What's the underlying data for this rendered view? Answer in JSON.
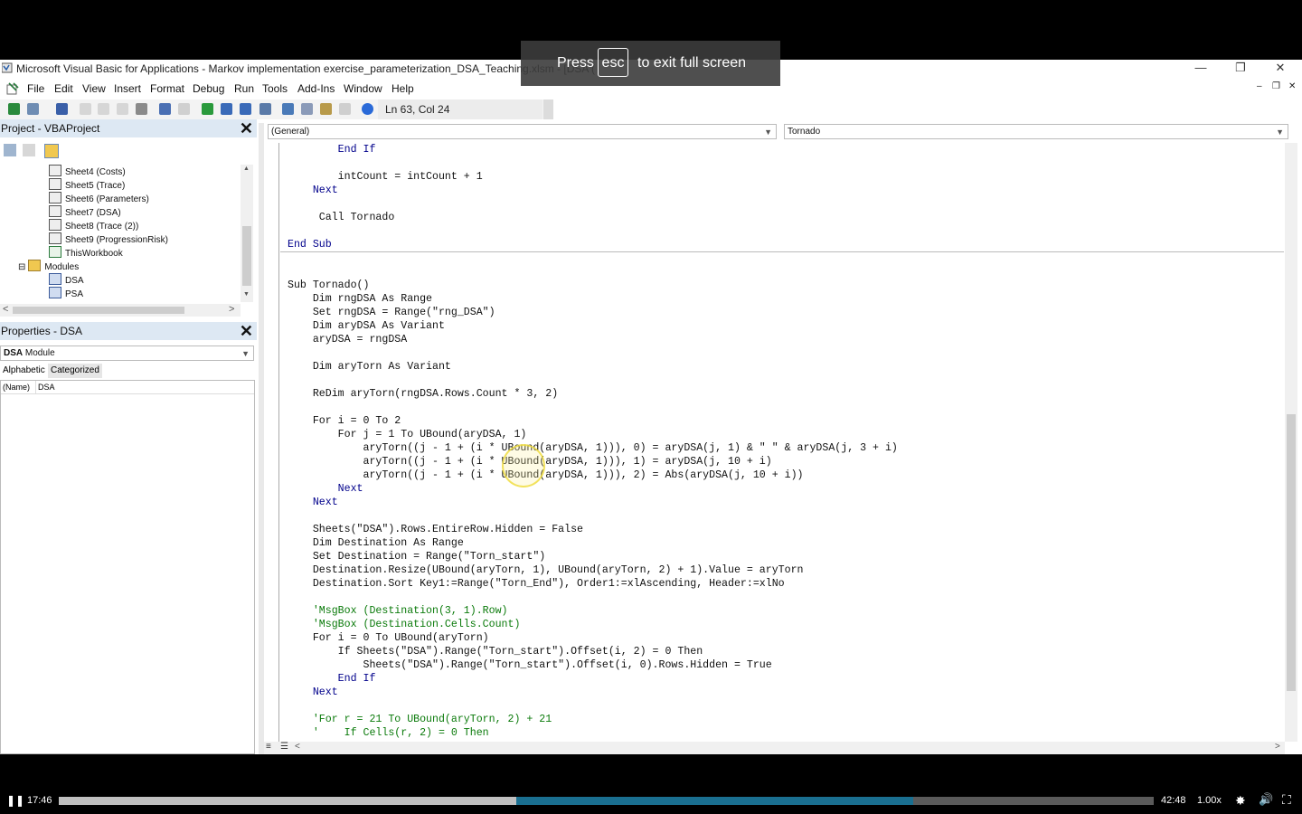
{
  "window": {
    "title": "Microsoft Visual Basic for Applications - Markov implementation exercise_parameterization_DSA_Teaching.xlsm - [DSA (",
    "minimize": "—",
    "restore": "❐",
    "close": "✕"
  },
  "menu": {
    "items": [
      "File",
      "Edit",
      "View",
      "Insert",
      "Format",
      "Debug",
      "Run",
      "Tools",
      "Add-Ins",
      "Window",
      "Help"
    ],
    "mdi_minimize": "–",
    "mdi_restore": "❐",
    "mdi_close": "✕"
  },
  "toolbar": {
    "position": "Ln 63, Col 24"
  },
  "project_pane": {
    "title": "Project - VBAProject",
    "close": "✕",
    "items": [
      {
        "label": "Sheet4 (Costs)",
        "type": "sheet"
      },
      {
        "label": "Sheet5 (Trace)",
        "type": "sheet"
      },
      {
        "label": "Sheet6 (Parameters)",
        "type": "sheet"
      },
      {
        "label": "Sheet7 (DSA)",
        "type": "sheet"
      },
      {
        "label": "Sheet8 (Trace (2))",
        "type": "sheet"
      },
      {
        "label": "Sheet9 (ProgressionRisk)",
        "type": "sheet"
      },
      {
        "label": "ThisWorkbook",
        "type": "workbook"
      },
      {
        "label": "Modules",
        "type": "folder",
        "expander": "⊟"
      },
      {
        "label": "DSA",
        "type": "module"
      },
      {
        "label": "PSA",
        "type": "module"
      }
    ],
    "scroll_left": "<",
    "scroll_right": ">",
    "scroll_up": "▲",
    "scroll_down": "▼"
  },
  "properties_pane": {
    "title": "Properties - DSA",
    "close": "✕",
    "object_selector_bold": "DSA",
    "object_selector_rest": " Module",
    "tabs": [
      "Alphabetic",
      "Categorized"
    ],
    "rows": [
      {
        "key": "(Name)",
        "value": "DSA"
      }
    ]
  },
  "code_window": {
    "object_dropdown": "(General)",
    "procedure_dropdown": "Tornado",
    "lines_top": [
      {
        "text": "        End If",
        "cls": "kw"
      },
      {
        "text": "",
        "cls": ""
      },
      {
        "text": "        intCount = intCount + 1",
        "cls": ""
      },
      {
        "text": "    Next",
        "cls": "kw"
      },
      {
        "text": "",
        "cls": ""
      },
      {
        "text": "     Call Tornado",
        "cls": ""
      },
      {
        "text": "",
        "cls": ""
      },
      {
        "text": "End Sub",
        "cls": "kw"
      }
    ],
    "lines_bottom": [
      {
        "text": "Sub Tornado()",
        "cls": ""
      },
      {
        "text": "    Dim rngDSA As Range",
        "cls": ""
      },
      {
        "text": "    Set rngDSA = Range(\"rng_DSA\")",
        "cls": ""
      },
      {
        "text": "    Dim aryDSA As Variant",
        "cls": ""
      },
      {
        "text": "    aryDSA = rngDSA",
        "cls": ""
      },
      {
        "text": "",
        "cls": ""
      },
      {
        "text": "    Dim aryTorn As Variant",
        "cls": ""
      },
      {
        "text": "",
        "cls": ""
      },
      {
        "text": "    ReDim aryTorn(rngDSA.Rows.Count * 3, 2)",
        "cls": ""
      },
      {
        "text": "",
        "cls": ""
      },
      {
        "text": "    For i = 0 To 2",
        "cls": ""
      },
      {
        "text": "        For j = 1 To UBound(aryDSA, 1)",
        "cls": ""
      },
      {
        "text": "            aryTorn((j - 1 + (i * UBound(aryDSA, 1))), 0) = aryDSA(j, 1) & \" \" & aryDSA(j, 3 + i)",
        "cls": ""
      },
      {
        "text": "            aryTorn((j - 1 + (i * UBound(aryDSA, 1))), 1) = aryDSA(j, 10 + i)",
        "cls": ""
      },
      {
        "text": "            aryTorn((j - 1 + (i * UBound(aryDSA, 1))), 2) = Abs(aryDSA(j, 10 + i))",
        "cls": ""
      },
      {
        "text": "        Next",
        "cls": "kw"
      },
      {
        "text": "    Next",
        "cls": "kw"
      },
      {
        "text": "",
        "cls": ""
      },
      {
        "text": "    Sheets(\"DSA\").Rows.EntireRow.Hidden = False",
        "cls": ""
      },
      {
        "text": "    Dim Destination As Range",
        "cls": ""
      },
      {
        "text": "    Set Destination = Range(\"Torn_start\")",
        "cls": ""
      },
      {
        "text": "    Destination.Resize(UBound(aryTorn, 1), UBound(aryTorn, 2) + 1).Value = aryTorn",
        "cls": ""
      },
      {
        "text": "    Destination.Sort Key1:=Range(\"Torn_End\"), Order1:=xlAscending, Header:=xlNo",
        "cls": ""
      },
      {
        "text": "",
        "cls": ""
      },
      {
        "text": "    'MsgBox (Destination(3, 1).Row)",
        "cls": "cm"
      },
      {
        "text": "    'MsgBox (Destination.Cells.Count)",
        "cls": "cm"
      },
      {
        "text": "    For i = 0 To UBound(aryTorn)",
        "cls": ""
      },
      {
        "text": "        If Sheets(\"DSA\").Range(\"Torn_start\").Offset(i, 2) = 0 Then",
        "cls": ""
      },
      {
        "text": "            Sheets(\"DSA\").Range(\"Torn_start\").Offset(i, 0).Rows.Hidden = True",
        "cls": ""
      },
      {
        "text": "        End If",
        "cls": "kw"
      },
      {
        "text": "    Next",
        "cls": "kw"
      },
      {
        "text": "",
        "cls": ""
      },
      {
        "text": "    'For r = 21 To UBound(aryTorn, 2) + 21",
        "cls": "cm"
      },
      {
        "text": "    '    If Cells(r, 2) = 0 Then",
        "cls": "cm"
      }
    ]
  },
  "fullscreen_notice": {
    "before": "Press",
    "key": "esc",
    "after": "to exit full screen"
  },
  "player": {
    "pause": "❚❚",
    "elapsed": "17:46",
    "duration": "42:48",
    "speed": "1.00x",
    "progress": 0.418,
    "buffered": 0.78,
    "settings_icon": "✸",
    "volume_icon": "🔊",
    "fullscreen_icon": "⛶"
  },
  "colors": {
    "keyword": "#00008b",
    "comment": "#0a7a0a",
    "progress": "#1a9cc9"
  }
}
